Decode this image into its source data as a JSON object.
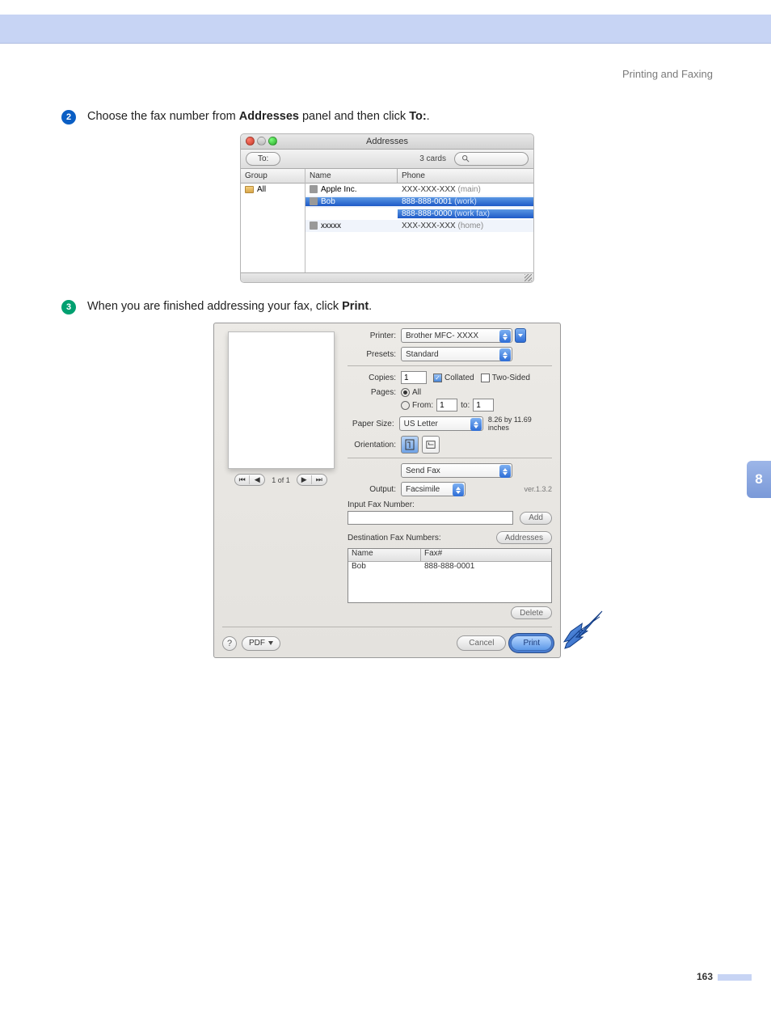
{
  "header_trail": "Printing and Faxing",
  "step2": {
    "num": "2",
    "pre": "Choose the fax number from ",
    "bold1": "Addresses",
    "mid": " panel and then click ",
    "bold2": "To:",
    "post": "."
  },
  "step3": {
    "num": "3",
    "pre": "When you are finished addressing your fax, click ",
    "bold1": "Print",
    "post": "."
  },
  "side_tab": "8",
  "page_number": "163",
  "addresses": {
    "title": "Addresses",
    "to_button": "To:",
    "cards_label": "3 cards",
    "search_placeholder": "",
    "group_header": "Group",
    "name_header": "Name",
    "phone_header": "Phone",
    "groups": [
      {
        "label": "All"
      }
    ],
    "rows": [
      {
        "name": "Apple Inc.",
        "phone": "XXX-XXX-XXX",
        "type": "(main)",
        "selname": false,
        "sel": false,
        "alt": false
      },
      {
        "name": "Bob",
        "phone": "888-888-0001",
        "type": "(work)",
        "selname": true,
        "sel": true,
        "alt": true
      },
      {
        "name": "",
        "phone": "888-888-0000",
        "type": "(work fax)",
        "selname": false,
        "sel": true,
        "alt": false
      },
      {
        "name": "xxxxx",
        "phone": "XXX-XXX-XXX",
        "type": "(home)",
        "selname": false,
        "sel": false,
        "alt": true
      }
    ]
  },
  "print": {
    "labels": {
      "printer": "Printer:",
      "presets": "Presets:",
      "copies": "Copies:",
      "pages": "Pages:",
      "from": "From:",
      "to": "to:",
      "papersize": "Paper Size:",
      "orientation": "Orientation:",
      "output": "Output:",
      "input_fax": "Input Fax Number:",
      "dest": "Destination Fax Numbers:"
    },
    "printer_value": "Brother MFC- XXXX",
    "presets_value": "Standard",
    "copies_value": "1",
    "collated_label": "Collated",
    "twosided_label": "Two-Sided",
    "pages_all": "All",
    "from_value": "1",
    "to_value": "1",
    "papersize_value": "US Letter",
    "papersize_dims": "8.26 by 11.69 inches",
    "panel_value": "Send Fax",
    "output_value": "Facsimile",
    "version": "ver.1.3.2",
    "input_fax_value": "",
    "add_btn": "Add",
    "addresses_btn": "Addresses",
    "dest_headers": {
      "name": "Name",
      "fax": "Fax#"
    },
    "dest_rows": [
      {
        "name": "Bob",
        "fax": "888-888-0001"
      }
    ],
    "delete_btn": "Delete",
    "pdf_btn": "PDF",
    "cancel_btn": "Cancel",
    "print_btn": "Print",
    "pager": "1 of 1"
  }
}
